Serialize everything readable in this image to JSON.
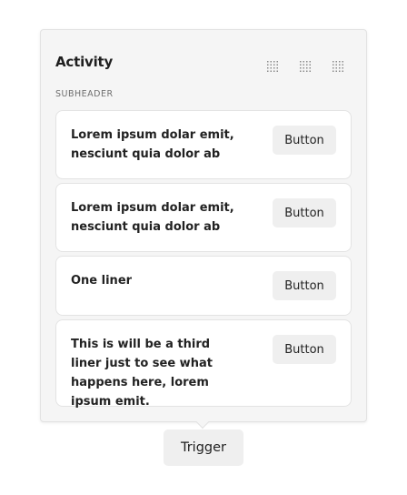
{
  "popover": {
    "title": "Activity",
    "subheader": "SUBHEADER",
    "header_icons": [
      "grid-icon",
      "grid-icon",
      "grid-icon"
    ],
    "cards": [
      {
        "text": "Lorem ipsum dolar emit, nesciunt quia dolor ab",
        "button_label": "Button"
      },
      {
        "text": "Lorem ipsum dolar emit, nesciunt quia dolor ab",
        "button_label": "Button"
      },
      {
        "text": "One liner",
        "button_label": "Button"
      },
      {
        "text": "This is will be a third liner just to see what happens here, lorem ipsum emit.",
        "button_label": "Button"
      }
    ]
  },
  "trigger": {
    "label": "Trigger"
  }
}
